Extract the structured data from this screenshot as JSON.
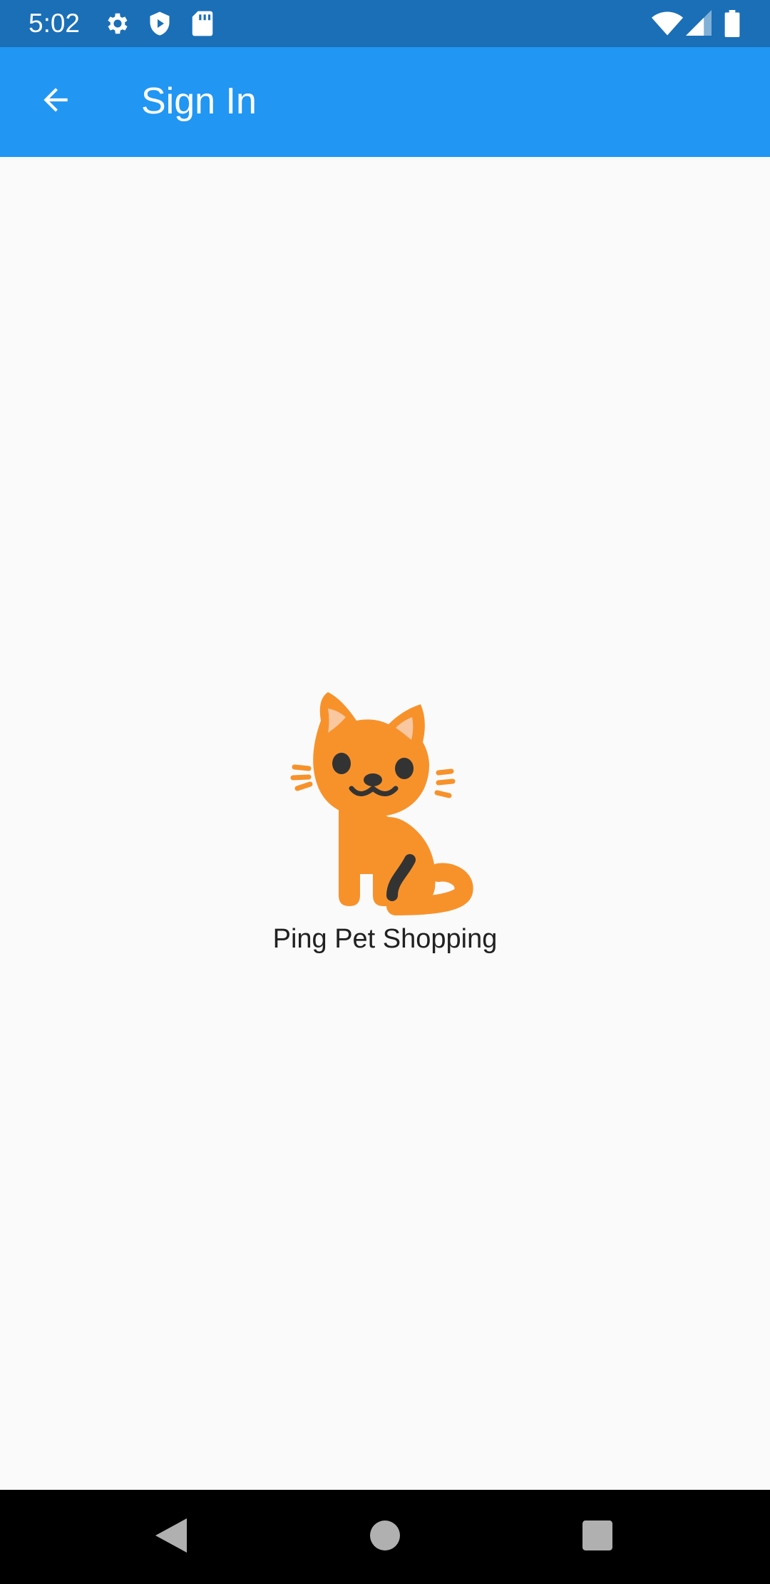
{
  "status_bar": {
    "time": "5:02",
    "left_icons": [
      "gear-icon",
      "shield-play-icon",
      "sd-card-icon"
    ],
    "right_icons": [
      "wifi-icon",
      "cell-signal-icon",
      "battery-icon"
    ]
  },
  "app_bar": {
    "title": "Sign In",
    "back_icon": "arrow-back-icon",
    "background": "#2196f3"
  },
  "main": {
    "logo_icon": "cat-icon",
    "app_name": "Ping Pet Shopping"
  },
  "nav_bar": {
    "buttons": [
      "back-triangle-icon",
      "home-circle-icon",
      "recents-square-icon"
    ]
  },
  "colors": {
    "status_bar": "#1a6fb7",
    "app_bar": "#2196f3",
    "cat_orange": "#f7922b",
    "cat_dark": "#333333",
    "background": "#fafafa"
  }
}
